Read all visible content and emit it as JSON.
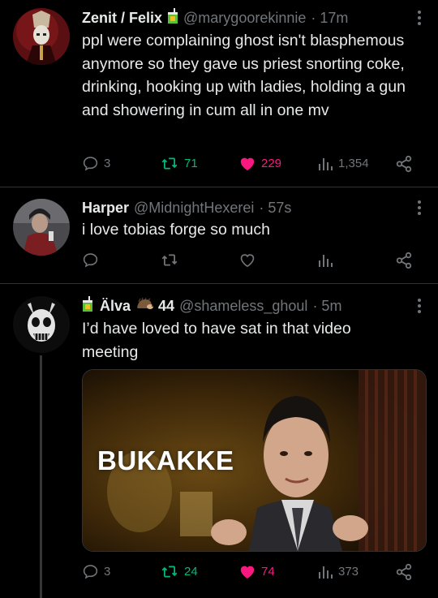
{
  "tweets": [
    {
      "display_name": "Zenit / Felix",
      "badge_icon": "juice-box-emoji",
      "handle": "@marygoorekinnie",
      "time": "· 17m",
      "text": "ppl were complaining ghost isn't blasphemous anymore so they gave us priest snorting coke, drinking, hooking up with ladies, holding a gun and showering in cum all in one mv",
      "stats": {
        "replies": "3",
        "retweets": "71",
        "likes": "229",
        "views": "1,354"
      }
    },
    {
      "display_name": "Harper",
      "handle": "@MidnightHexerei",
      "time": "· 57s",
      "text": "i love tobias forge so much",
      "stats": {
        "replies": "",
        "retweets": "",
        "likes": "",
        "views": ""
      }
    },
    {
      "display_name": "Älva",
      "name_suffix": "44",
      "badge_icon": "juice-box-emoji",
      "suffix_icon": "hedgehog-emoji",
      "handle": "@shameless_ghoul",
      "time": "· 5m",
      "text": "I’d have loved to have sat in that video meeting",
      "media_caption": "BUKAKKE",
      "stats": {
        "replies": "3",
        "retweets": "24",
        "likes": "74",
        "views": "373"
      }
    }
  ],
  "colors": {
    "background": "#000000",
    "text": "#e7e9ea",
    "muted": "#71767b",
    "retweet": "#00ba7c",
    "like": "#f91880",
    "divider": "#2f3336"
  }
}
